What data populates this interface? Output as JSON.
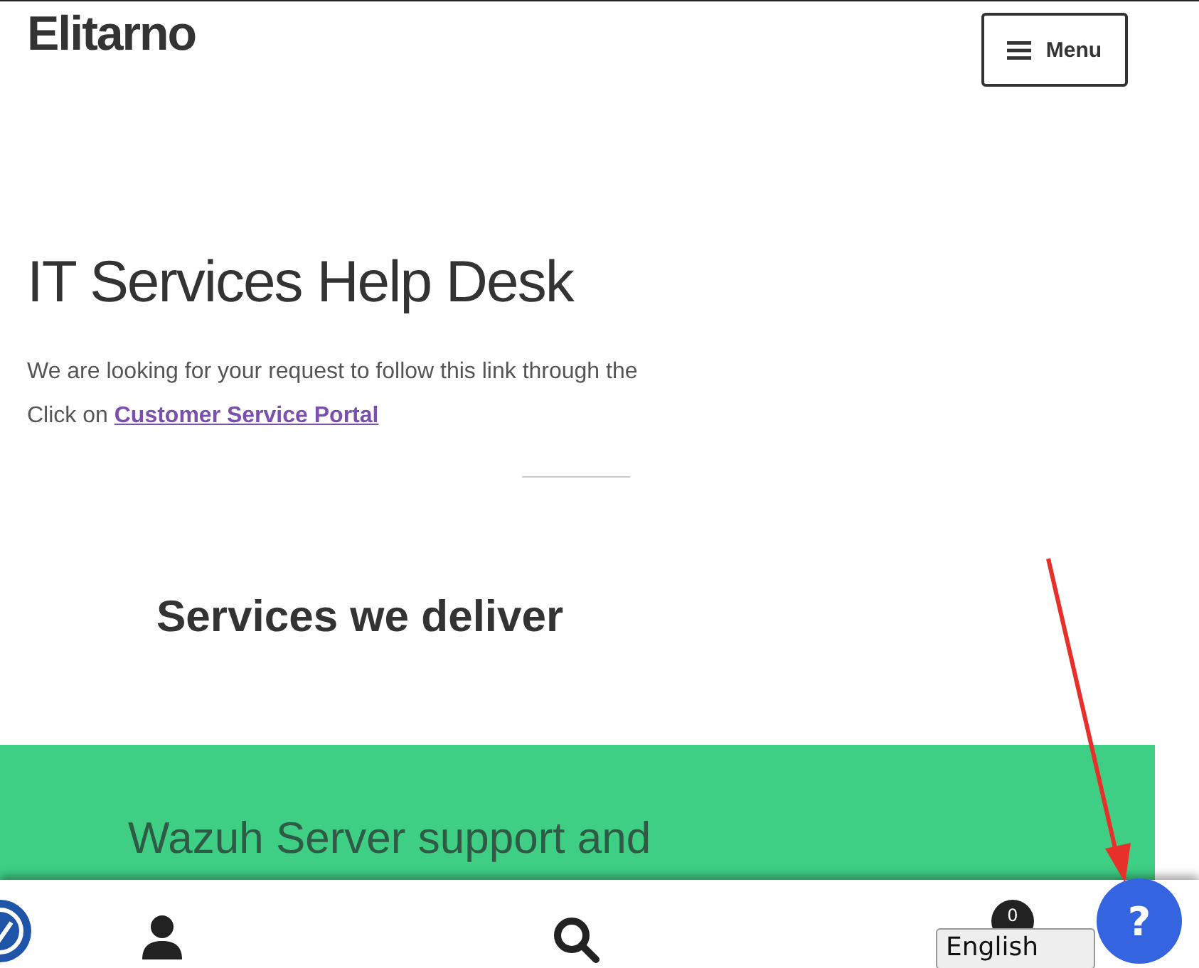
{
  "header": {
    "site_title": "Elitarno",
    "menu_button": "Menu"
  },
  "hero": {
    "title": "IT Services Help Desk",
    "intro_line": "We are looking for your request to follow this link through the",
    "link_prefix": "Click on",
    "link": "Customer Service Portal"
  },
  "services": {
    "heading": "Services we deliver",
    "card_title": "Wazuh Server support and"
  },
  "bottom_bar": {
    "cart_count": "0",
    "language": "English",
    "help_button": "?"
  }
}
